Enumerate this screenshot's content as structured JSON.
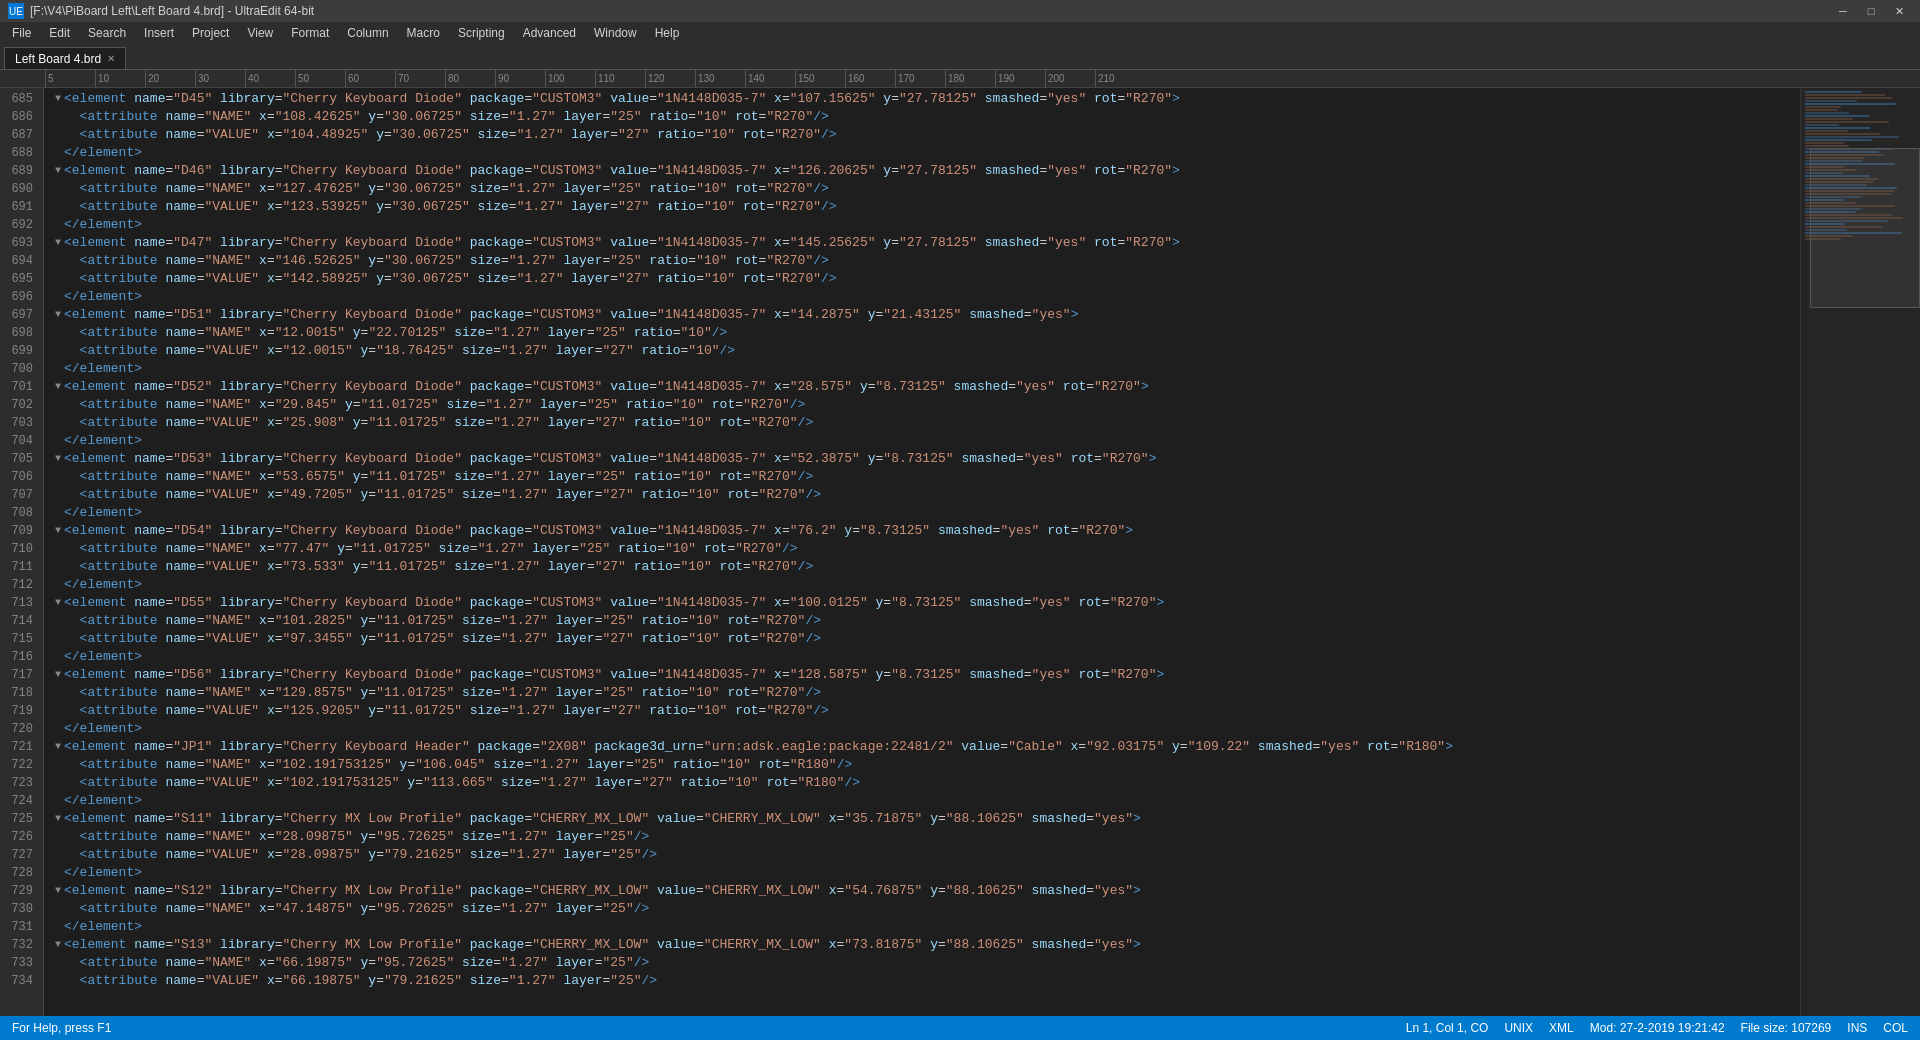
{
  "window": {
    "title": "[F:\\V4\\PiBoard Left\\Left Board 4.brd] - UltraEdit 64-bit",
    "icon": "UE"
  },
  "menu": {
    "items": [
      "File",
      "Edit",
      "Search",
      "Insert",
      "Project",
      "View",
      "Format",
      "Column",
      "Macro",
      "Scripting",
      "Advanced",
      "Window",
      "Help"
    ]
  },
  "tabs": [
    {
      "label": "Left Board 4.brd",
      "active": true
    }
  ],
  "ruler": {
    "marks": [
      "5",
      "10",
      "20",
      "30",
      "40",
      "50",
      "60",
      "70",
      "80",
      "90",
      "100",
      "110",
      "120",
      "130",
      "140",
      "150",
      "160",
      "170",
      "180",
      "190",
      "200",
      "210"
    ]
  },
  "lines": [
    {
      "num": 685,
      "fold": "▼",
      "indent": 0,
      "content": "<element name=\"D45\" library=\"Cherry Keyboard Diode\" package=\"CUSTOM3\" value=\"1N4148D035-7\" x=\"107.15625\" y=\"27.78125\" smashed=\"yes\" rot=\"R270\">"
    },
    {
      "num": 686,
      "fold": "",
      "indent": 1,
      "content": "<attribute name=\"NAME\" x=\"108.42625\" y=\"30.06725\" size=\"1.27\" layer=\"25\" ratio=\"10\" rot=\"R270\"/>"
    },
    {
      "num": 687,
      "fold": "",
      "indent": 1,
      "content": "<attribute name=\"VALUE\" x=\"104.48925\" y=\"30.06725\" size=\"1.27\" layer=\"27\" ratio=\"10\" rot=\"R270\"/>"
    },
    {
      "num": 688,
      "fold": "",
      "indent": 0,
      "content": "</element>"
    },
    {
      "num": 689,
      "fold": "▼",
      "indent": 0,
      "content": "<element name=\"D46\" library=\"Cherry Keyboard Diode\" package=\"CUSTOM3\" value=\"1N4148D035-7\" x=\"126.20625\" y=\"27.78125\" smashed=\"yes\" rot=\"R270\">"
    },
    {
      "num": 690,
      "fold": "",
      "indent": 1,
      "content": "<attribute name=\"NAME\" x=\"127.47625\" y=\"30.06725\" size=\"1.27\" layer=\"25\" ratio=\"10\" rot=\"R270\"/>"
    },
    {
      "num": 691,
      "fold": "",
      "indent": 1,
      "content": "<attribute name=\"VALUE\" x=\"123.53925\" y=\"30.06725\" size=\"1.27\" layer=\"27\" ratio=\"10\" rot=\"R270\"/>"
    },
    {
      "num": 692,
      "fold": "",
      "indent": 0,
      "content": "</element>"
    },
    {
      "num": 693,
      "fold": "▼",
      "indent": 0,
      "content": "<element name=\"D47\" library=\"Cherry Keyboard Diode\" package=\"CUSTOM3\" value=\"1N4148D035-7\" x=\"145.25625\" y=\"27.78125\" smashed=\"yes\" rot=\"R270\">"
    },
    {
      "num": 694,
      "fold": "",
      "indent": 1,
      "content": "<attribute name=\"NAME\" x=\"146.52625\" y=\"30.06725\" size=\"1.27\" layer=\"25\" ratio=\"10\" rot=\"R270\"/>"
    },
    {
      "num": 695,
      "fold": "",
      "indent": 1,
      "content": "<attribute name=\"VALUE\" x=\"142.58925\" y=\"30.06725\" size=\"1.27\" layer=\"27\" ratio=\"10\" rot=\"R270\"/>"
    },
    {
      "num": 696,
      "fold": "",
      "indent": 0,
      "content": "</element>"
    },
    {
      "num": 697,
      "fold": "▼",
      "indent": 0,
      "content": "<element name=\"D51\" library=\"Cherry Keyboard Diode\" package=\"CUSTOM3\" value=\"1N4148D035-7\" x=\"14.2875\" y=\"21.43125\" smashed=\"yes\">"
    },
    {
      "num": 698,
      "fold": "",
      "indent": 1,
      "content": "<attribute name=\"NAME\" x=\"12.0015\" y=\"22.70125\" size=\"1.27\" layer=\"25\" ratio=\"10\"/>"
    },
    {
      "num": 699,
      "fold": "",
      "indent": 1,
      "content": "<attribute name=\"VALUE\" x=\"12.0015\" y=\"18.76425\" size=\"1.27\" layer=\"27\" ratio=\"10\"/>"
    },
    {
      "num": 700,
      "fold": "",
      "indent": 0,
      "content": "</element>"
    },
    {
      "num": 701,
      "fold": "▼",
      "indent": 0,
      "content": "<element name=\"D52\" library=\"Cherry Keyboard Diode\" package=\"CUSTOM3\" value=\"1N4148D035-7\" x=\"28.575\" y=\"8.73125\" smashed=\"yes\" rot=\"R270\">"
    },
    {
      "num": 702,
      "fold": "",
      "indent": 1,
      "content": "<attribute name=\"NAME\" x=\"29.845\" y=\"11.01725\" size=\"1.27\" layer=\"25\" ratio=\"10\" rot=\"R270\"/>"
    },
    {
      "num": 703,
      "fold": "",
      "indent": 1,
      "content": "<attribute name=\"VALUE\" x=\"25.908\" y=\"11.01725\" size=\"1.27\" layer=\"27\" ratio=\"10\" rot=\"R270\"/>"
    },
    {
      "num": 704,
      "fold": "",
      "indent": 0,
      "content": "</element>"
    },
    {
      "num": 705,
      "fold": "▼",
      "indent": 0,
      "content": "<element name=\"D53\" library=\"Cherry Keyboard Diode\" package=\"CUSTOM3\" value=\"1N4148D035-7\" x=\"52.3875\" y=\"8.73125\" smashed=\"yes\" rot=\"R270\">"
    },
    {
      "num": 706,
      "fold": "",
      "indent": 1,
      "content": "<attribute name=\"NAME\" x=\"53.6575\" y=\"11.01725\" size=\"1.27\" layer=\"25\" ratio=\"10\" rot=\"R270\"/>"
    },
    {
      "num": 707,
      "fold": "",
      "indent": 1,
      "content": "<attribute name=\"VALUE\" x=\"49.7205\" y=\"11.01725\" size=\"1.27\" layer=\"27\" ratio=\"10\" rot=\"R270\"/>"
    },
    {
      "num": 708,
      "fold": "",
      "indent": 0,
      "content": "</element>"
    },
    {
      "num": 709,
      "fold": "▼",
      "indent": 0,
      "content": "<element name=\"D54\" library=\"Cherry Keyboard Diode\" package=\"CUSTOM3\" value=\"1N4148D035-7\" x=\"76.2\" y=\"8.73125\" smashed=\"yes\" rot=\"R270\">"
    },
    {
      "num": 710,
      "fold": "",
      "indent": 1,
      "content": "<attribute name=\"NAME\" x=\"77.47\" y=\"11.01725\" size=\"1.27\" layer=\"25\" ratio=\"10\" rot=\"R270\"/>"
    },
    {
      "num": 711,
      "fold": "",
      "indent": 1,
      "content": "<attribute name=\"VALUE\" x=\"73.533\" y=\"11.01725\" size=\"1.27\" layer=\"27\" ratio=\"10\" rot=\"R270\"/>"
    },
    {
      "num": 712,
      "fold": "",
      "indent": 0,
      "content": "</element>"
    },
    {
      "num": 713,
      "fold": "▼",
      "indent": 0,
      "content": "<element name=\"D55\" library=\"Cherry Keyboard Diode\" package=\"CUSTOM3\" value=\"1N4148D035-7\" x=\"100.0125\" y=\"8.73125\" smashed=\"yes\" rot=\"R270\">"
    },
    {
      "num": 714,
      "fold": "",
      "indent": 1,
      "content": "<attribute name=\"NAME\" x=\"101.2825\" y=\"11.01725\" size=\"1.27\" layer=\"25\" ratio=\"10\" rot=\"R270\"/>"
    },
    {
      "num": 715,
      "fold": "",
      "indent": 1,
      "content": "<attribute name=\"VALUE\" x=\"97.3455\" y=\"11.01725\" size=\"1.27\" layer=\"27\" ratio=\"10\" rot=\"R270\"/>"
    },
    {
      "num": 716,
      "fold": "",
      "indent": 0,
      "content": "</element>"
    },
    {
      "num": 717,
      "fold": "▼",
      "indent": 0,
      "content": "<element name=\"D56\" library=\"Cherry Keyboard Diode\" package=\"CUSTOM3\" value=\"1N4148D035-7\" x=\"128.5875\" y=\"8.73125\" smashed=\"yes\" rot=\"R270\">"
    },
    {
      "num": 718,
      "fold": "",
      "indent": 1,
      "content": "<attribute name=\"NAME\" x=\"129.8575\" y=\"11.01725\" size=\"1.27\" layer=\"25\" ratio=\"10\" rot=\"R270\"/>"
    },
    {
      "num": 719,
      "fold": "",
      "indent": 1,
      "content": "<attribute name=\"VALUE\" x=\"125.9205\" y=\"11.01725\" size=\"1.27\" layer=\"27\" ratio=\"10\" rot=\"R270\"/>"
    },
    {
      "num": 720,
      "fold": "",
      "indent": 0,
      "content": "</element>"
    },
    {
      "num": 721,
      "fold": "▼",
      "indent": 0,
      "content": "<element name=\"JP1\" library=\"Cherry Keyboard Header\" package=\"2X08\" package3d_urn=\"urn:adsk.eagle:package:22481/2\" value=\"Cable\" x=\"92.03175\" y=\"109.22\" smashed=\"yes\" rot=\"R180\">"
    },
    {
      "num": 722,
      "fold": "",
      "indent": 1,
      "content": "<attribute name=\"NAME\" x=\"102.191753125\" y=\"106.045\" size=\"1.27\" layer=\"25\" ratio=\"10\" rot=\"R180\"/>"
    },
    {
      "num": 723,
      "fold": "",
      "indent": 1,
      "content": "<attribute name=\"VALUE\" x=\"102.191753125\" y=\"113.665\" size=\"1.27\" layer=\"27\" ratio=\"10\" rot=\"R180\"/>"
    },
    {
      "num": 724,
      "fold": "",
      "indent": 0,
      "content": "</element>"
    },
    {
      "num": 725,
      "fold": "▼",
      "indent": 0,
      "content": "<element name=\"S11\" library=\"Cherry MX Low Profile\" package=\"CHERRY_MX_LOW\" value=\"CHERRY_MX_LOW\" x=\"35.71875\" y=\"88.10625\" smashed=\"yes\">"
    },
    {
      "num": 726,
      "fold": "",
      "indent": 1,
      "content": "<attribute name=\"NAME\" x=\"28.09875\" y=\"95.72625\" size=\"1.27\" layer=\"25\"/>"
    },
    {
      "num": 727,
      "fold": "",
      "indent": 1,
      "content": "<attribute name=\"VALUE\" x=\"28.09875\" y=\"79.21625\" size=\"1.27\" layer=\"25\"/>"
    },
    {
      "num": 728,
      "fold": "",
      "indent": 0,
      "content": "</element>"
    },
    {
      "num": 729,
      "fold": "▼",
      "indent": 0,
      "content": "<element name=\"S12\" library=\"Cherry MX Low Profile\" package=\"CHERRY_MX_LOW\" value=\"CHERRY_MX_LOW\" x=\"54.76875\" y=\"88.10625\" smashed=\"yes\">"
    },
    {
      "num": 730,
      "fold": "",
      "indent": 1,
      "content": "<attribute name=\"NAME\" x=\"47.14875\" y=\"95.72625\" size=\"1.27\" layer=\"25\"/>"
    },
    {
      "num": 731,
      "fold": "",
      "indent": 0,
      "content": "</element>"
    },
    {
      "num": 732,
      "fold": "▼",
      "indent": 0,
      "content": "<element name=\"S13\" library=\"Cherry MX Low Profile\" package=\"CHERRY_MX_LOW\" value=\"CHERRY_MX_LOW\" x=\"73.81875\" y=\"88.10625\" smashed=\"yes\">"
    },
    {
      "num": 733,
      "fold": "",
      "indent": 1,
      "content": "<attribute name=\"NAME\" x=\"66.19875\" y=\"95.72625\" size=\"1.27\" layer=\"25\"/>"
    },
    {
      "num": 734,
      "fold": "",
      "indent": 1,
      "content": "<attribute name=\"VALUE\" x=\"66.19875\" y=\"79.21625\" size=\"1.27\" layer=\"25\"/>"
    }
  ],
  "status": {
    "help": "For Help, press F1",
    "position": "Ln 1, Col 1, CO",
    "unix": "UNIX",
    "xml": "XML",
    "mod_date": "Mod: 27-2-2019 19:21:42",
    "file_size": "File size: 107269",
    "ins": "INS",
    "col": "COL"
  },
  "accent_colors": {
    "tag": "#569cd6",
    "attr_name": "#9cdcfe",
    "attr_value": "#ce9178",
    "element_tag": "#d4d4d4",
    "close_tag": "#569cd6"
  }
}
